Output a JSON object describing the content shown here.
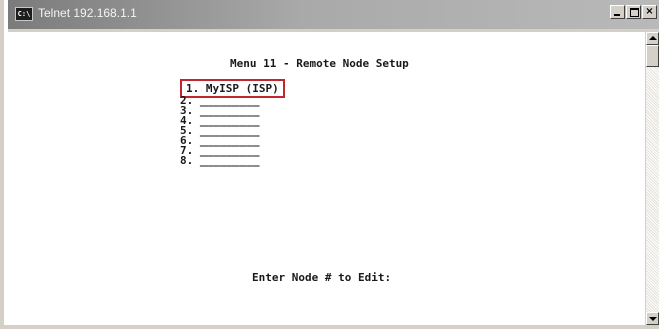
{
  "window": {
    "title": "Telnet 192.168.1.1",
    "icon": "console-icon",
    "icon_text": "C:\\"
  },
  "controls": {
    "minimize_icon": "minimize-icon",
    "maximize_icon": "maximize-icon",
    "close_icon": "close-icon",
    "close_label": "×"
  },
  "terminal": {
    "heading": "Menu 11 - Remote Node Setup",
    "nodes": [
      "1. MyISP (ISP)",
      "2. _________",
      "3. _________",
      "4. _________",
      "5. _________",
      "6. _________",
      "7. _________",
      "8. _________"
    ],
    "prompt": "Enter Node # to Edit:",
    "highlight_color": "#c0262e"
  },
  "colors": {
    "titlebar_start": "#7b7b7b",
    "titlebar_end": "#b9b9b9",
    "chrome": "#d4d0c8",
    "terminal_bg": "#ffffff",
    "terminal_text": "#1a1a1a"
  }
}
